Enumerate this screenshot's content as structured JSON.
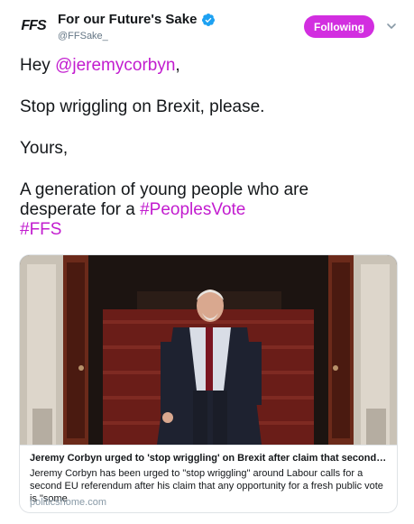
{
  "author": {
    "avatar_text": "FFS",
    "display_name": "For our Future's Sake",
    "handle": "@FFSake_",
    "verified": true
  },
  "actions": {
    "follow_label": "Following",
    "menu_icon": "chevron-down-icon"
  },
  "tweet": {
    "line1_prefix": "Hey ",
    "mention": "@jeremycorbyn",
    "line1_suffix": ",",
    "line2": "Stop wriggling on Brexit, please.",
    "line3": "Yours,",
    "line4": "A generation of young people who are",
    "line5_prefix": "desperate for a ",
    "hashtag1": "#PeoplesVote",
    "hashtag2": "#FFS"
  },
  "card": {
    "title": "Jeremy Corbyn urged to 'stop wriggling' on Brexit after claim that second referendum...",
    "description": "Jeremy Corbyn has been urged to \"stop wriggling\" around Labour calls for a second EU referendum after his claim that any opportunity for a fresh public vote is \"some",
    "domain": "politicshome.com"
  },
  "colors": {
    "accent": "#d22ee0",
    "link": "#c21ccf",
    "text": "#14171a",
    "muted": "#657786",
    "verified": "#1da1f2"
  }
}
